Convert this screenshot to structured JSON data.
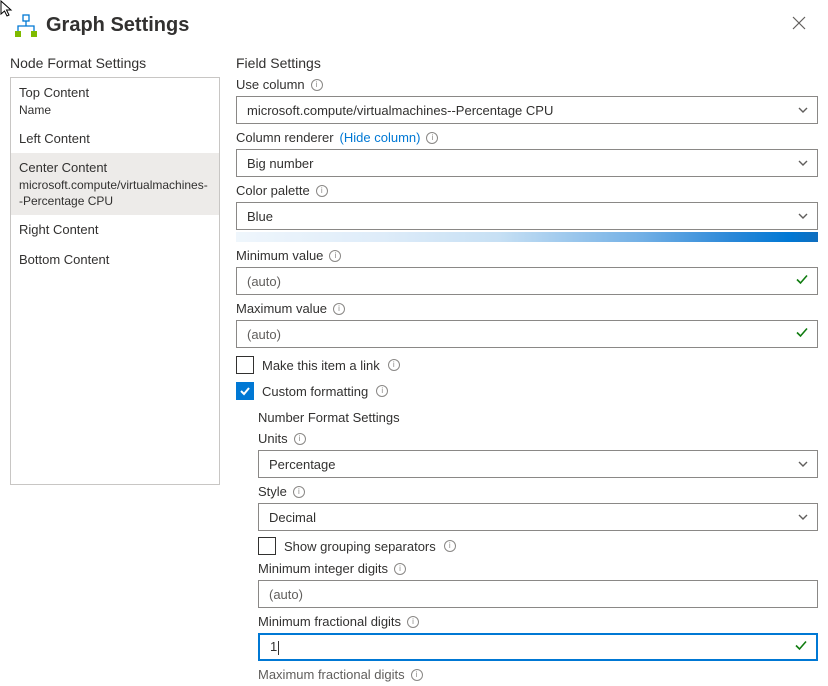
{
  "header": {
    "title": "Graph Settings"
  },
  "left": {
    "title": "Node Format Settings",
    "items": [
      {
        "label": "Top Content",
        "sub": "Name"
      },
      {
        "label": "Left Content",
        "sub": ""
      },
      {
        "label": "Center Content",
        "sub": "microsoft.compute/virtualmachines--Percentage CPU"
      },
      {
        "label": "Right Content",
        "sub": ""
      },
      {
        "label": "Bottom Content",
        "sub": ""
      }
    ],
    "selectedIndex": 2
  },
  "right": {
    "title": "Field Settings",
    "useColumn": {
      "label": "Use column",
      "value": "microsoft.compute/virtualmachines--Percentage CPU"
    },
    "columnRenderer": {
      "label": "Column renderer",
      "link": "(Hide column)",
      "value": "Big number"
    },
    "colorPalette": {
      "label": "Color palette",
      "value": "Blue"
    },
    "minimumValue": {
      "label": "Minimum value",
      "value": "(auto)"
    },
    "maximumValue": {
      "label": "Maximum value",
      "value": "(auto)"
    },
    "makeLink": {
      "label": "Make this item a link",
      "checked": false
    },
    "customFormatting": {
      "label": "Custom formatting",
      "checked": true
    },
    "numberFormat": {
      "title": "Number Format Settings",
      "units": {
        "label": "Units",
        "value": "Percentage"
      },
      "style": {
        "label": "Style",
        "value": "Decimal"
      },
      "groupSep": {
        "label": "Show grouping separators",
        "checked": false
      },
      "minIntDigits": {
        "label": "Minimum integer digits",
        "value": "(auto)"
      },
      "minFracDigits": {
        "label": "Minimum fractional digits",
        "value": "1"
      },
      "maxFracDigits": {
        "label": "Maximum fractional digits"
      }
    }
  }
}
